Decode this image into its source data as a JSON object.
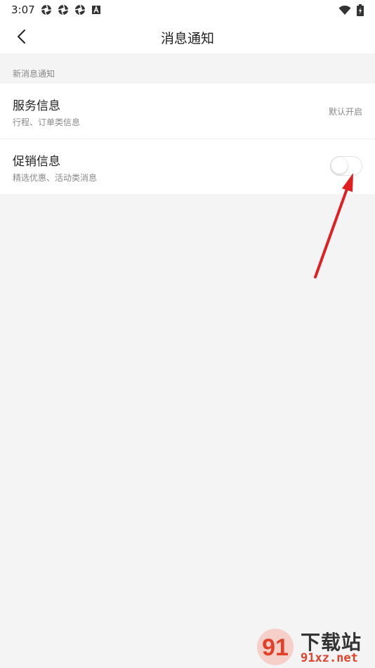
{
  "status_bar": {
    "time": "3:07",
    "left_icons": [
      "aperture-icon",
      "aperture-icon",
      "aperture-icon",
      "a-box-icon"
    ],
    "right_icons": [
      "wifi-icon",
      "battery-icon"
    ]
  },
  "header": {
    "title": "消息通知",
    "back_icon": "chevron-left-icon"
  },
  "section": {
    "header": "新消息通知"
  },
  "settings": [
    {
      "title": "服务信息",
      "subtitle": "行程、订单类信息",
      "status": "默认开启"
    },
    {
      "title": "促销信息",
      "subtitle": "精选优惠、活动类消息",
      "toggle_on": false
    }
  ],
  "annotation": {
    "color": "#e02020"
  },
  "watermark": {
    "title": "下载站",
    "url": "91xz.net",
    "accent": "#e0412b"
  }
}
